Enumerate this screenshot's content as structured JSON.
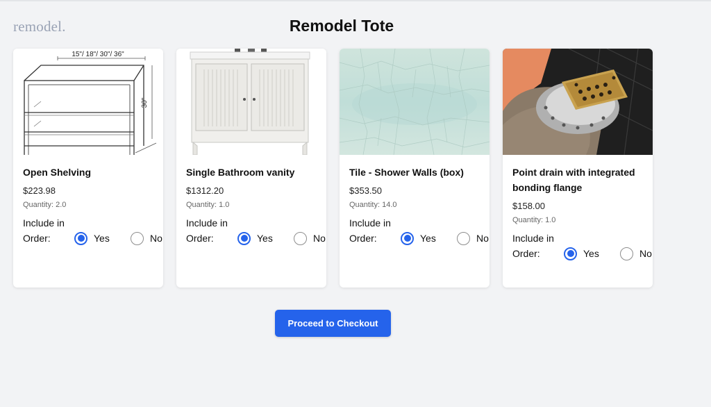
{
  "logo": "remodel.",
  "title": "Remodel Tote",
  "items": [
    {
      "name": "Open Shelving",
      "price": "$223.98",
      "quantity": "Quantity: 2.0",
      "include_label": "Include in Order:",
      "yes_label": "Yes",
      "no_label": "No",
      "selected": "Yes",
      "image_text": {
        "width": "15\"/ 18\"/ 30\"/ 36\"",
        "height": "30\""
      }
    },
    {
      "name": "Single Bathroom vanity",
      "price": "$1312.20",
      "quantity": "Quantity: 1.0",
      "include_label": "Include in Order:",
      "yes_label": "Yes",
      "no_label": "No",
      "selected": "Yes"
    },
    {
      "name": "Tile - Shower Walls (box)",
      "price": "$353.50",
      "quantity": "Quantity: 14.0",
      "include_label": "Include in Order:",
      "yes_label": "Yes",
      "no_label": "No",
      "selected": "Yes"
    },
    {
      "name": "Point drain with integrated bonding flange",
      "price": "$158.00",
      "quantity": "Quantity: 1.0",
      "include_label": "Include in Order:",
      "yes_label": "Yes",
      "no_label": "No",
      "selected": "Yes"
    }
  ],
  "checkout_label": "Proceed to Checkout",
  "colors": {
    "accent": "#2563eb",
    "background": "#f2f3f5",
    "logo": "#9aa3b5"
  }
}
